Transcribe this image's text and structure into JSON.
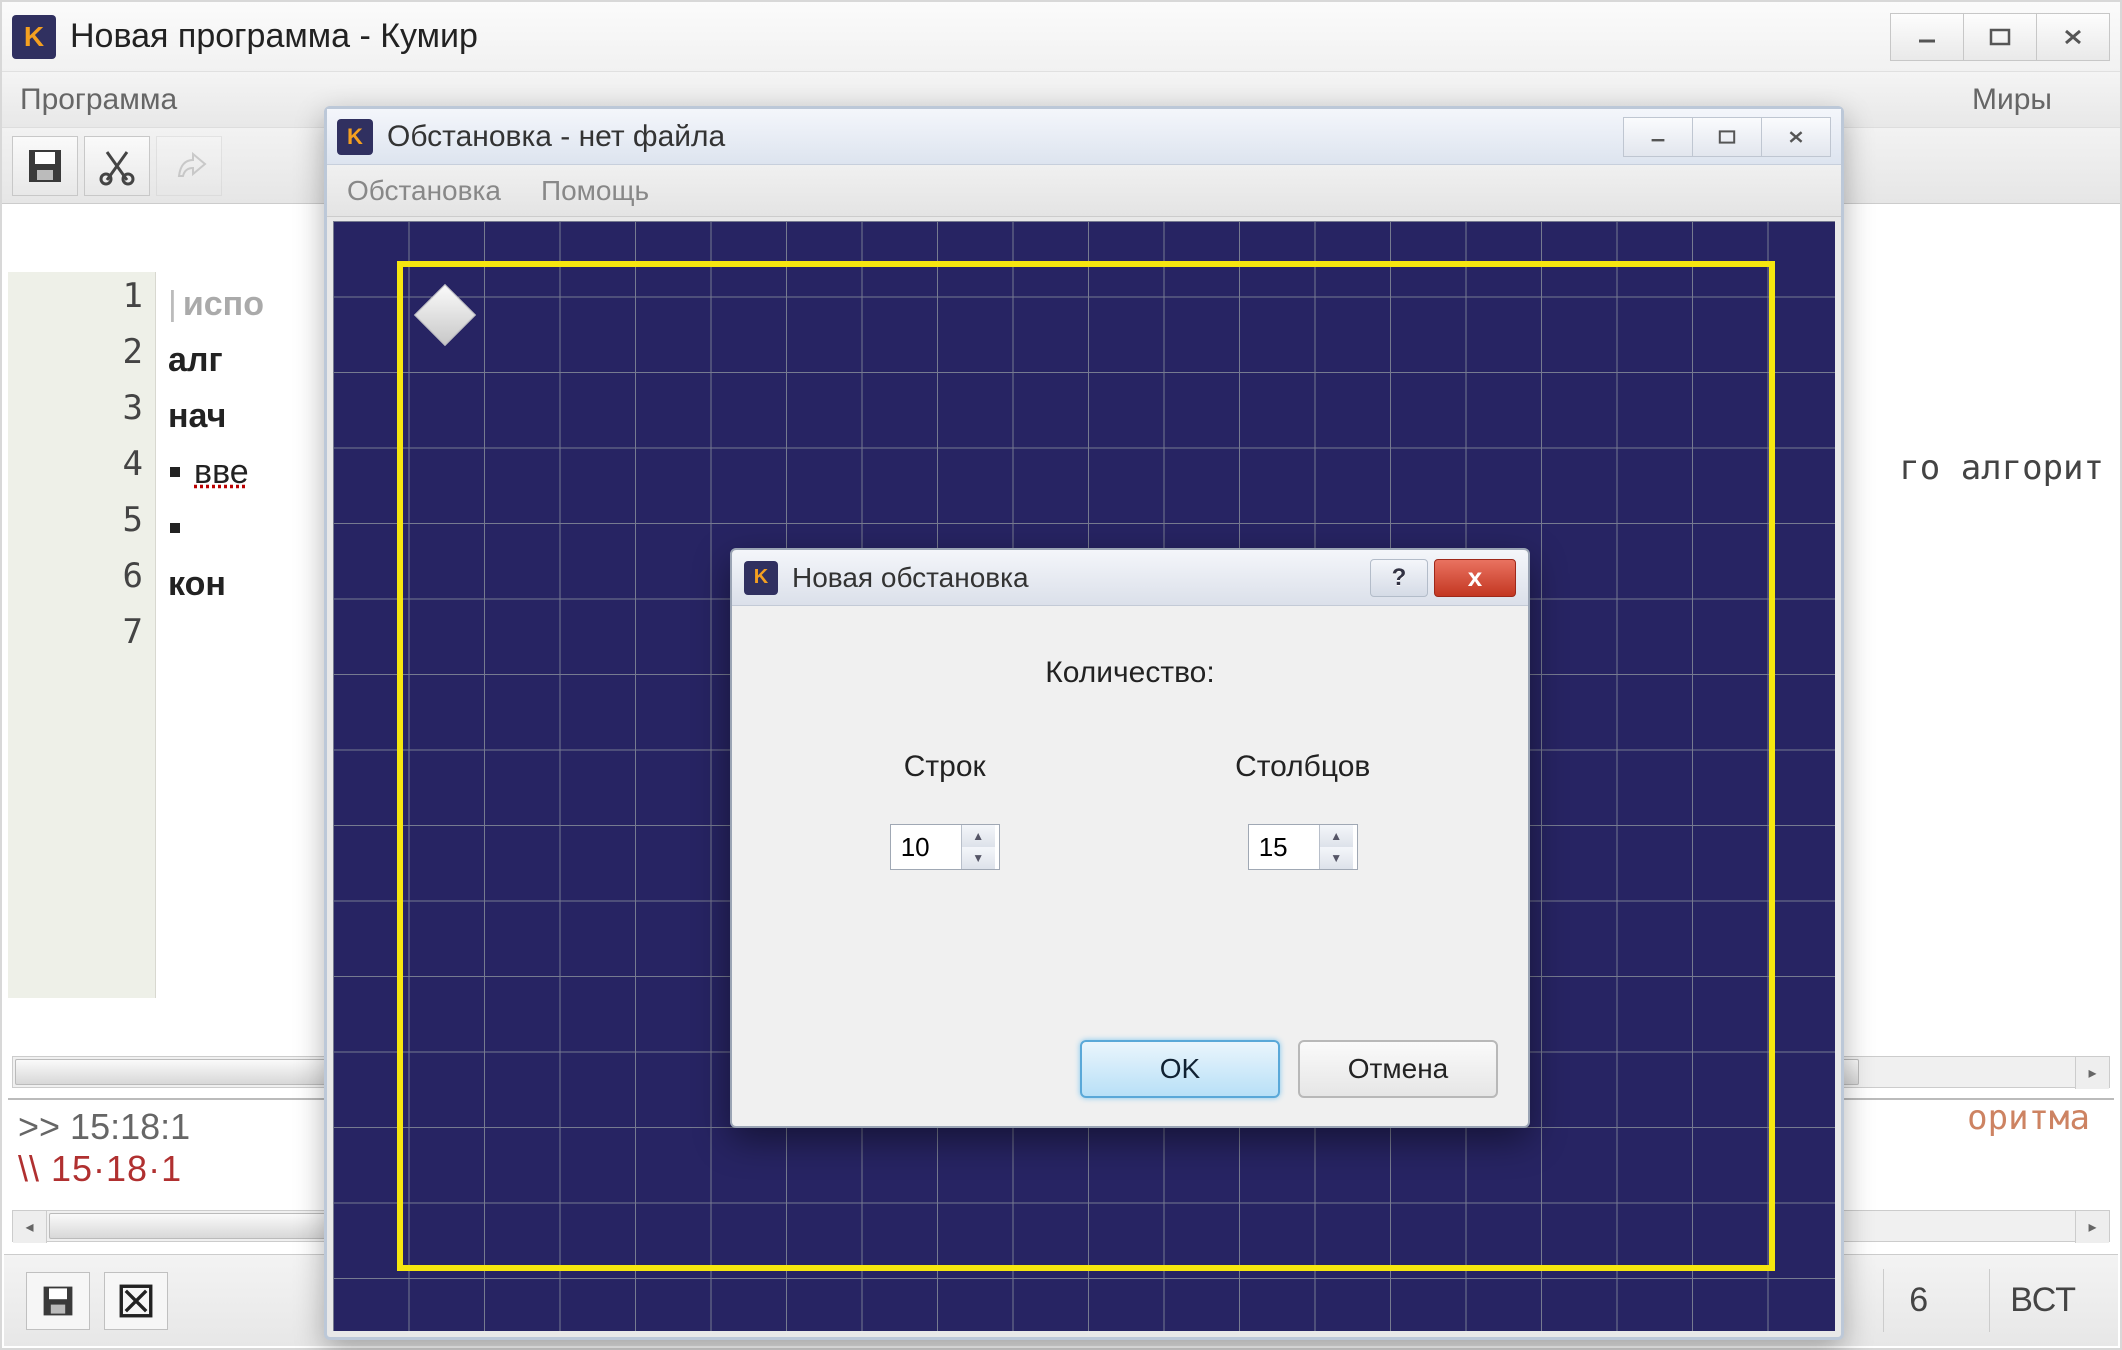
{
  "main_window": {
    "title": "Новая программа - Кумир",
    "menu": {
      "program": "Программа",
      "worlds": "Миры"
    }
  },
  "editor": {
    "lines": [
      "испо",
      "алг",
      "нач",
      "вве",
      "",
      "кон",
      ""
    ],
    "right_tail": "го алгорит",
    "line_numbers": [
      "1",
      "2",
      "3",
      "4",
      "5",
      "6",
      "7"
    ]
  },
  "console": {
    "line1": ">> 15:18:1",
    "line2": "\\\\ 15·18·1",
    "right_tail": "оритма"
  },
  "statusbar": {
    "num": "6",
    "mode": "ВСТ"
  },
  "child_window": {
    "title": "Обстановка - нет файла",
    "menu": {
      "env": "Обстановка",
      "help": "Помощь"
    }
  },
  "dialog": {
    "title": "Новая обстановка",
    "heading": "Количество:",
    "rows_label": "Строк",
    "cols_label": "Столбцов",
    "rows_value": "10",
    "cols_value": "15",
    "ok": "OK",
    "cancel": "Отмена",
    "help": "?",
    "close": "x"
  }
}
